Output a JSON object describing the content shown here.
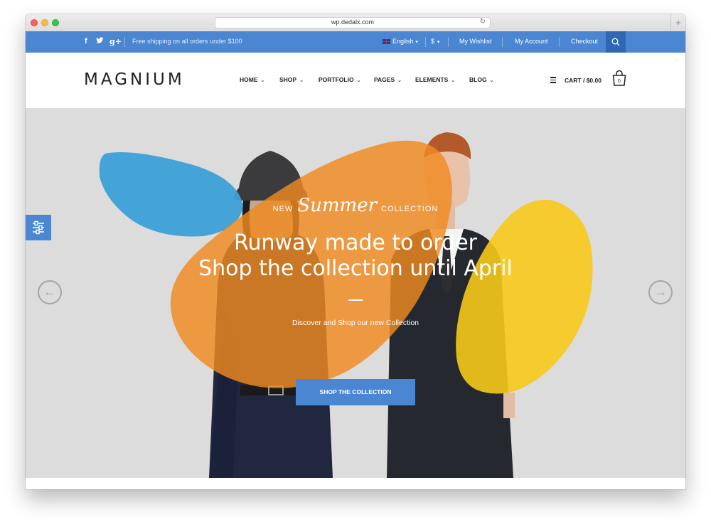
{
  "browser": {
    "url": "wp.dedalx.com",
    "new_tab": "+"
  },
  "topbar": {
    "shipping": "Free shipping on all orders under $100",
    "language": "English",
    "currency": "$",
    "links": [
      "My Wishlist",
      "My Account",
      "Checkout"
    ]
  },
  "header": {
    "logo": "MAGNIUM",
    "nav": [
      "HOME",
      "SHOP",
      "PORTFOLIO",
      "PAGES",
      "ELEMENTS",
      "BLOG"
    ],
    "cart_label": "CART / $0.00",
    "cart_count": "0"
  },
  "hero": {
    "pre": "NEW",
    "script": "Summer",
    "post": "COLLECTION",
    "title_line1": "Runway made to order",
    "title_line2": "Shop the collection until April",
    "description": "Discover and Shop our new Collection",
    "cta": "SHOP THE COLLECTION"
  },
  "colors": {
    "accent": "#4a86d1",
    "orange": "#f0902a",
    "yellow": "#f7c91a",
    "blue_blob": "#3b9fd6"
  }
}
